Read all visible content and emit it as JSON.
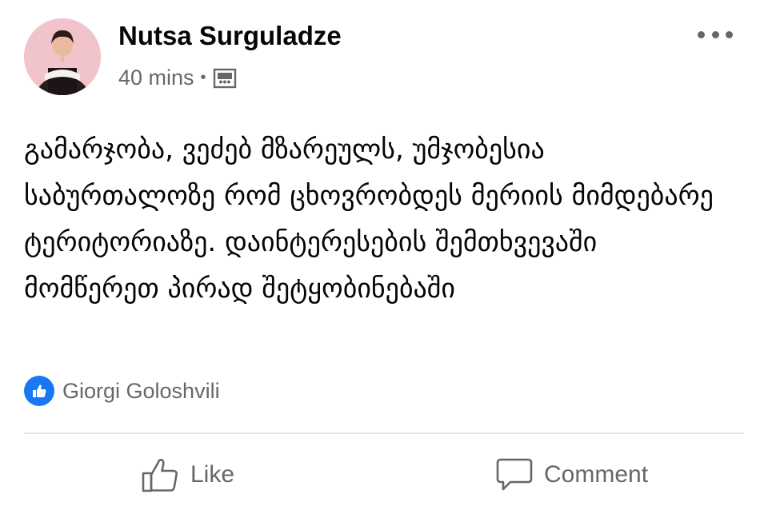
{
  "author": {
    "name": "Nutsa Surguladze",
    "time": "40 mins",
    "separator": "•",
    "audience_icon": "album-icon"
  },
  "post": {
    "text": "გამარჯობა, ვეძებ მზარეულს,  უმჯობესია საბურთალოზე რომ ცხოვრობდეს მერიის მიმდებარე ტერიტორიაზე. დაინტერესების შემთხვევაში მომწერეთ პირად შეტყობინებაში"
  },
  "reactions": {
    "icon": "like-icon",
    "names": "Giorgi Goloshvili",
    "color": "#1877f2"
  },
  "actions": {
    "like_label": "Like",
    "comment_label": "Comment"
  },
  "colors": {
    "text": "#050505",
    "secondary": "#65676b",
    "divider": "#e4e6eb"
  }
}
